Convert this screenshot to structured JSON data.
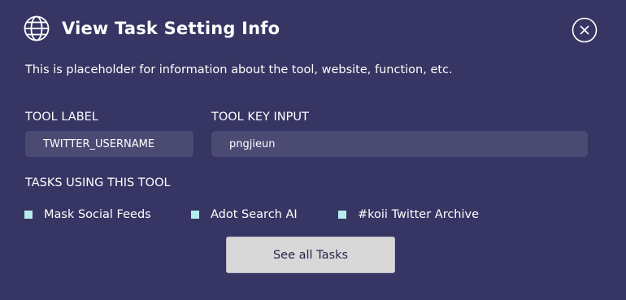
{
  "dialog": {
    "title": "View Task Setting Info",
    "description": "This is placeholder for information about the tool, website, function, etc.",
    "icon": "globe-icon",
    "close_icon": "close-icon"
  },
  "fields": {
    "tool_label": {
      "label": "TOOL LABEL",
      "value": "TWITTER_USERNAME"
    },
    "tool_key_input": {
      "label": "TOOL KEY INPUT",
      "value": "pngjieun"
    }
  },
  "tasks": {
    "heading": "TASKS USING THIS TOOL",
    "items": [
      "Mask Social Feeds",
      "Adot Search AI",
      "#koii Twitter Archive"
    ]
  },
  "actions": {
    "see_all_label": "See all Tasks"
  },
  "colors": {
    "background": "#363563",
    "input_background": "#4b4a73",
    "bullet": "#b7eded",
    "button_background": "#d8d8d8",
    "button_text": "#27264a"
  }
}
